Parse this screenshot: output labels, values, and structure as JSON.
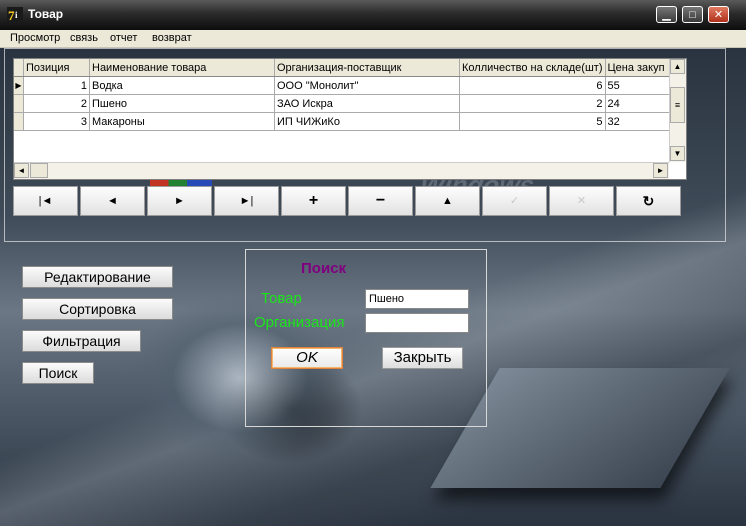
{
  "window": {
    "title": "Товар"
  },
  "menu": [
    "Просмотр",
    "связь",
    "отчет",
    "возврат"
  ],
  "grid": {
    "columns": [
      "Позиция",
      "Наименование товара",
      "Организация-поставщик",
      "Колличество на складе(шт)",
      "Цена закуп"
    ],
    "rows": [
      [
        "1",
        "Водка",
        "ООО \"Монолит\"",
        "6",
        "55"
      ],
      [
        "2",
        "Пшено",
        "ЗАО Искра",
        "2",
        "24"
      ],
      [
        "3",
        "Макароны",
        "ИП ЧИЖиКо",
        "5",
        "32"
      ]
    ]
  },
  "navigator": [
    {
      "name": "first-record-button",
      "glyph": "|◄",
      "enabled": true
    },
    {
      "name": "prior-record-button",
      "glyph": "◄",
      "enabled": true
    },
    {
      "name": "next-record-button",
      "glyph": "►",
      "enabled": true
    },
    {
      "name": "last-record-button",
      "glyph": "►|",
      "enabled": true
    },
    {
      "name": "insert-record-button",
      "glyph": "+",
      "enabled": true
    },
    {
      "name": "delete-record-button",
      "glyph": "−",
      "enabled": true
    },
    {
      "name": "edit-record-button",
      "glyph": "▲",
      "enabled": true
    },
    {
      "name": "post-record-button",
      "glyph": "✓",
      "enabled": false
    },
    {
      "name": "cancel-record-button",
      "glyph": "✕",
      "enabled": false
    },
    {
      "name": "refresh-record-button",
      "glyph": "↻",
      "enabled": true
    }
  ],
  "side_buttons": {
    "edit": "Редактирование",
    "sort": "Сортировка",
    "filter": "Фильтрация",
    "search": "Поиск"
  },
  "search_dialog": {
    "title": "Поиск",
    "product_label": "Товар",
    "product_value": "Пшено",
    "org_label": "Организация",
    "org_value": "",
    "ok_label": "OK",
    "close_label": "Закрыть"
  },
  "background_watermark": "Windows"
}
